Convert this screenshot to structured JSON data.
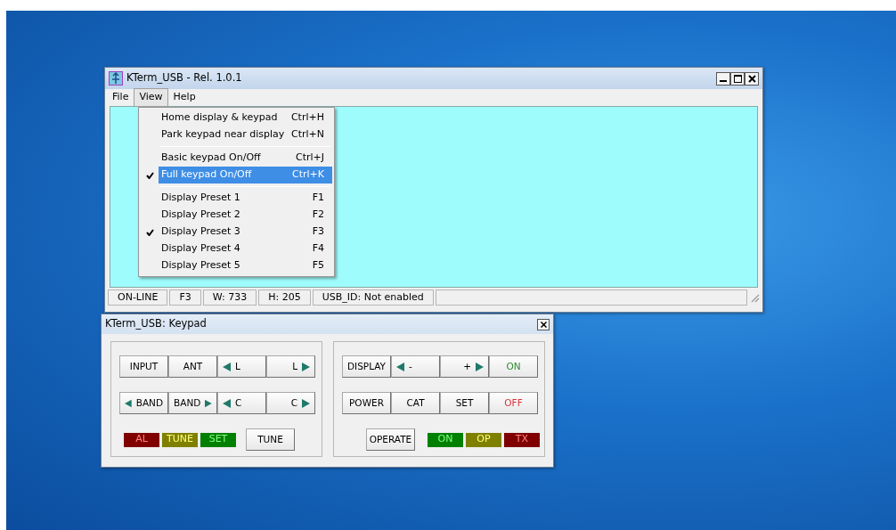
{
  "main_window": {
    "title": "KTerm_USB - Rel. 1.0.1",
    "menu": [
      {
        "label": "File",
        "selected": false
      },
      {
        "label": "View",
        "selected": true
      },
      {
        "label": "Help",
        "selected": false
      }
    ],
    "dropdown": [
      {
        "kind": "item",
        "label": "Home display & keypad",
        "shortcut": "Ctrl+H",
        "checked": false,
        "selected": false
      },
      {
        "kind": "item",
        "label": "Park keypad near display",
        "shortcut": "Ctrl+N",
        "checked": false,
        "selected": false
      },
      {
        "kind": "separator"
      },
      {
        "kind": "item",
        "label": "Basic keypad On/Off",
        "shortcut": "Ctrl+J",
        "checked": false,
        "selected": false
      },
      {
        "kind": "item",
        "label": "Full keypad On/Off",
        "shortcut": "Ctrl+K",
        "checked": true,
        "selected": true
      },
      {
        "kind": "separator"
      },
      {
        "kind": "item",
        "label": "Display Preset 1",
        "shortcut": "F1",
        "checked": false,
        "selected": false
      },
      {
        "kind": "item",
        "label": "Display Preset 2",
        "shortcut": "F2",
        "checked": false,
        "selected": false
      },
      {
        "kind": "item",
        "label": "Display Preset 3",
        "shortcut": "F3",
        "checked": true,
        "selected": false
      },
      {
        "kind": "item",
        "label": "Display Preset 4",
        "shortcut": "F4",
        "checked": false,
        "selected": false
      },
      {
        "kind": "item",
        "label": "Display Preset 5",
        "shortcut": "F5",
        "checked": false,
        "selected": false
      }
    ],
    "status_bar": [
      "ON-LINE",
      "F3",
      "W:  733",
      "H:  205",
      "USB_ID: Not enabled"
    ]
  },
  "keypad_window": {
    "title": "KTerm_USB: Keypad",
    "left_group": {
      "rows": [
        [
          {
            "kind": "plain",
            "label": "INPUT"
          },
          {
            "kind": "plain",
            "label": "ANT"
          },
          {
            "kind": "left",
            "label": "L"
          },
          {
            "kind": "right",
            "label": "L"
          }
        ],
        [
          {
            "kind": "left",
            "label": "BAND"
          },
          {
            "kind": "right",
            "label": "BAND"
          },
          {
            "kind": "left",
            "label": "C"
          },
          {
            "kind": "right",
            "label": "C"
          }
        ]
      ],
      "lamps": [
        {
          "label": "AL",
          "color": "#800000"
        },
        {
          "label": "TUNE",
          "color": "#808000"
        },
        {
          "label": "SET",
          "color": "#008000"
        }
      ],
      "button": "TUNE"
    },
    "right_group": {
      "rows": [
        [
          {
            "kind": "plain",
            "label": "DISPLAY"
          },
          {
            "kind": "left",
            "label": "-"
          },
          {
            "kind": "right",
            "label": "+"
          },
          {
            "kind": "plain",
            "label": "ON",
            "color": "#2e8b2e"
          }
        ],
        [
          {
            "kind": "plain",
            "label": "POWER"
          },
          {
            "kind": "plain",
            "label": "CAT"
          },
          {
            "kind": "plain",
            "label": "SET"
          },
          {
            "kind": "plain",
            "label": "OFF",
            "color": "#e0303a"
          }
        ]
      ],
      "button": "OPERATE",
      "lamps": [
        {
          "label": "ON",
          "color": "#008000"
        },
        {
          "label": "OP",
          "color": "#808000"
        },
        {
          "label": "TX",
          "color": "#800000"
        }
      ]
    }
  }
}
